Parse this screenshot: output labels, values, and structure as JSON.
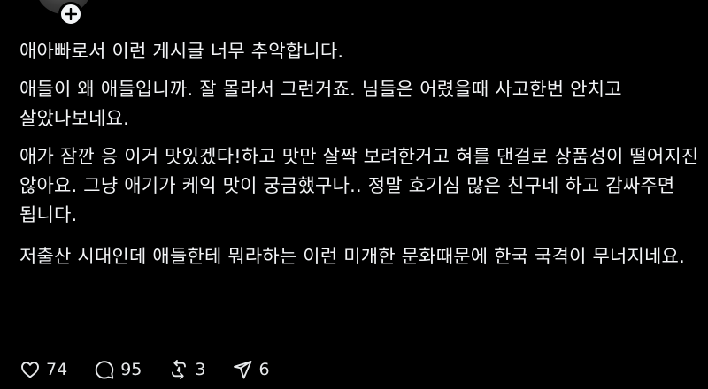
{
  "header": {
    "username_fragment": "......"
  },
  "post": {
    "paragraphs": [
      "애아빠로서 이런 게시글 너무 추악합니다.",
      "애들이 왜 애들입니까. 잘 몰라서 그런거죠. 님들은 어렸을때 사고한번 안치고 살았나보네요.",
      "애가 잠깐 응 이거 맛있겠다!하고 맛만 살짝 보려한거고 혀를 댄걸로 상품성이 떨어지진 않아요. 그냥 애기가 케익 맛이 궁금했구나.. 정말 호기심 많은 친구네 하고 감싸주면 됩니다.",
      "저출산 시대인데 애들한테 뭐라하는 이런 미개한 문화때문에 한국 국격이 무너지네요."
    ]
  },
  "actions": {
    "likes": "74",
    "replies": "95",
    "reposts": "3",
    "shares": "6",
    "icons": [
      "heart-icon",
      "comment-icon",
      "repost-icon",
      "send-icon"
    ]
  },
  "colors": {
    "background": "#000000",
    "text": "#f3f5f7"
  }
}
